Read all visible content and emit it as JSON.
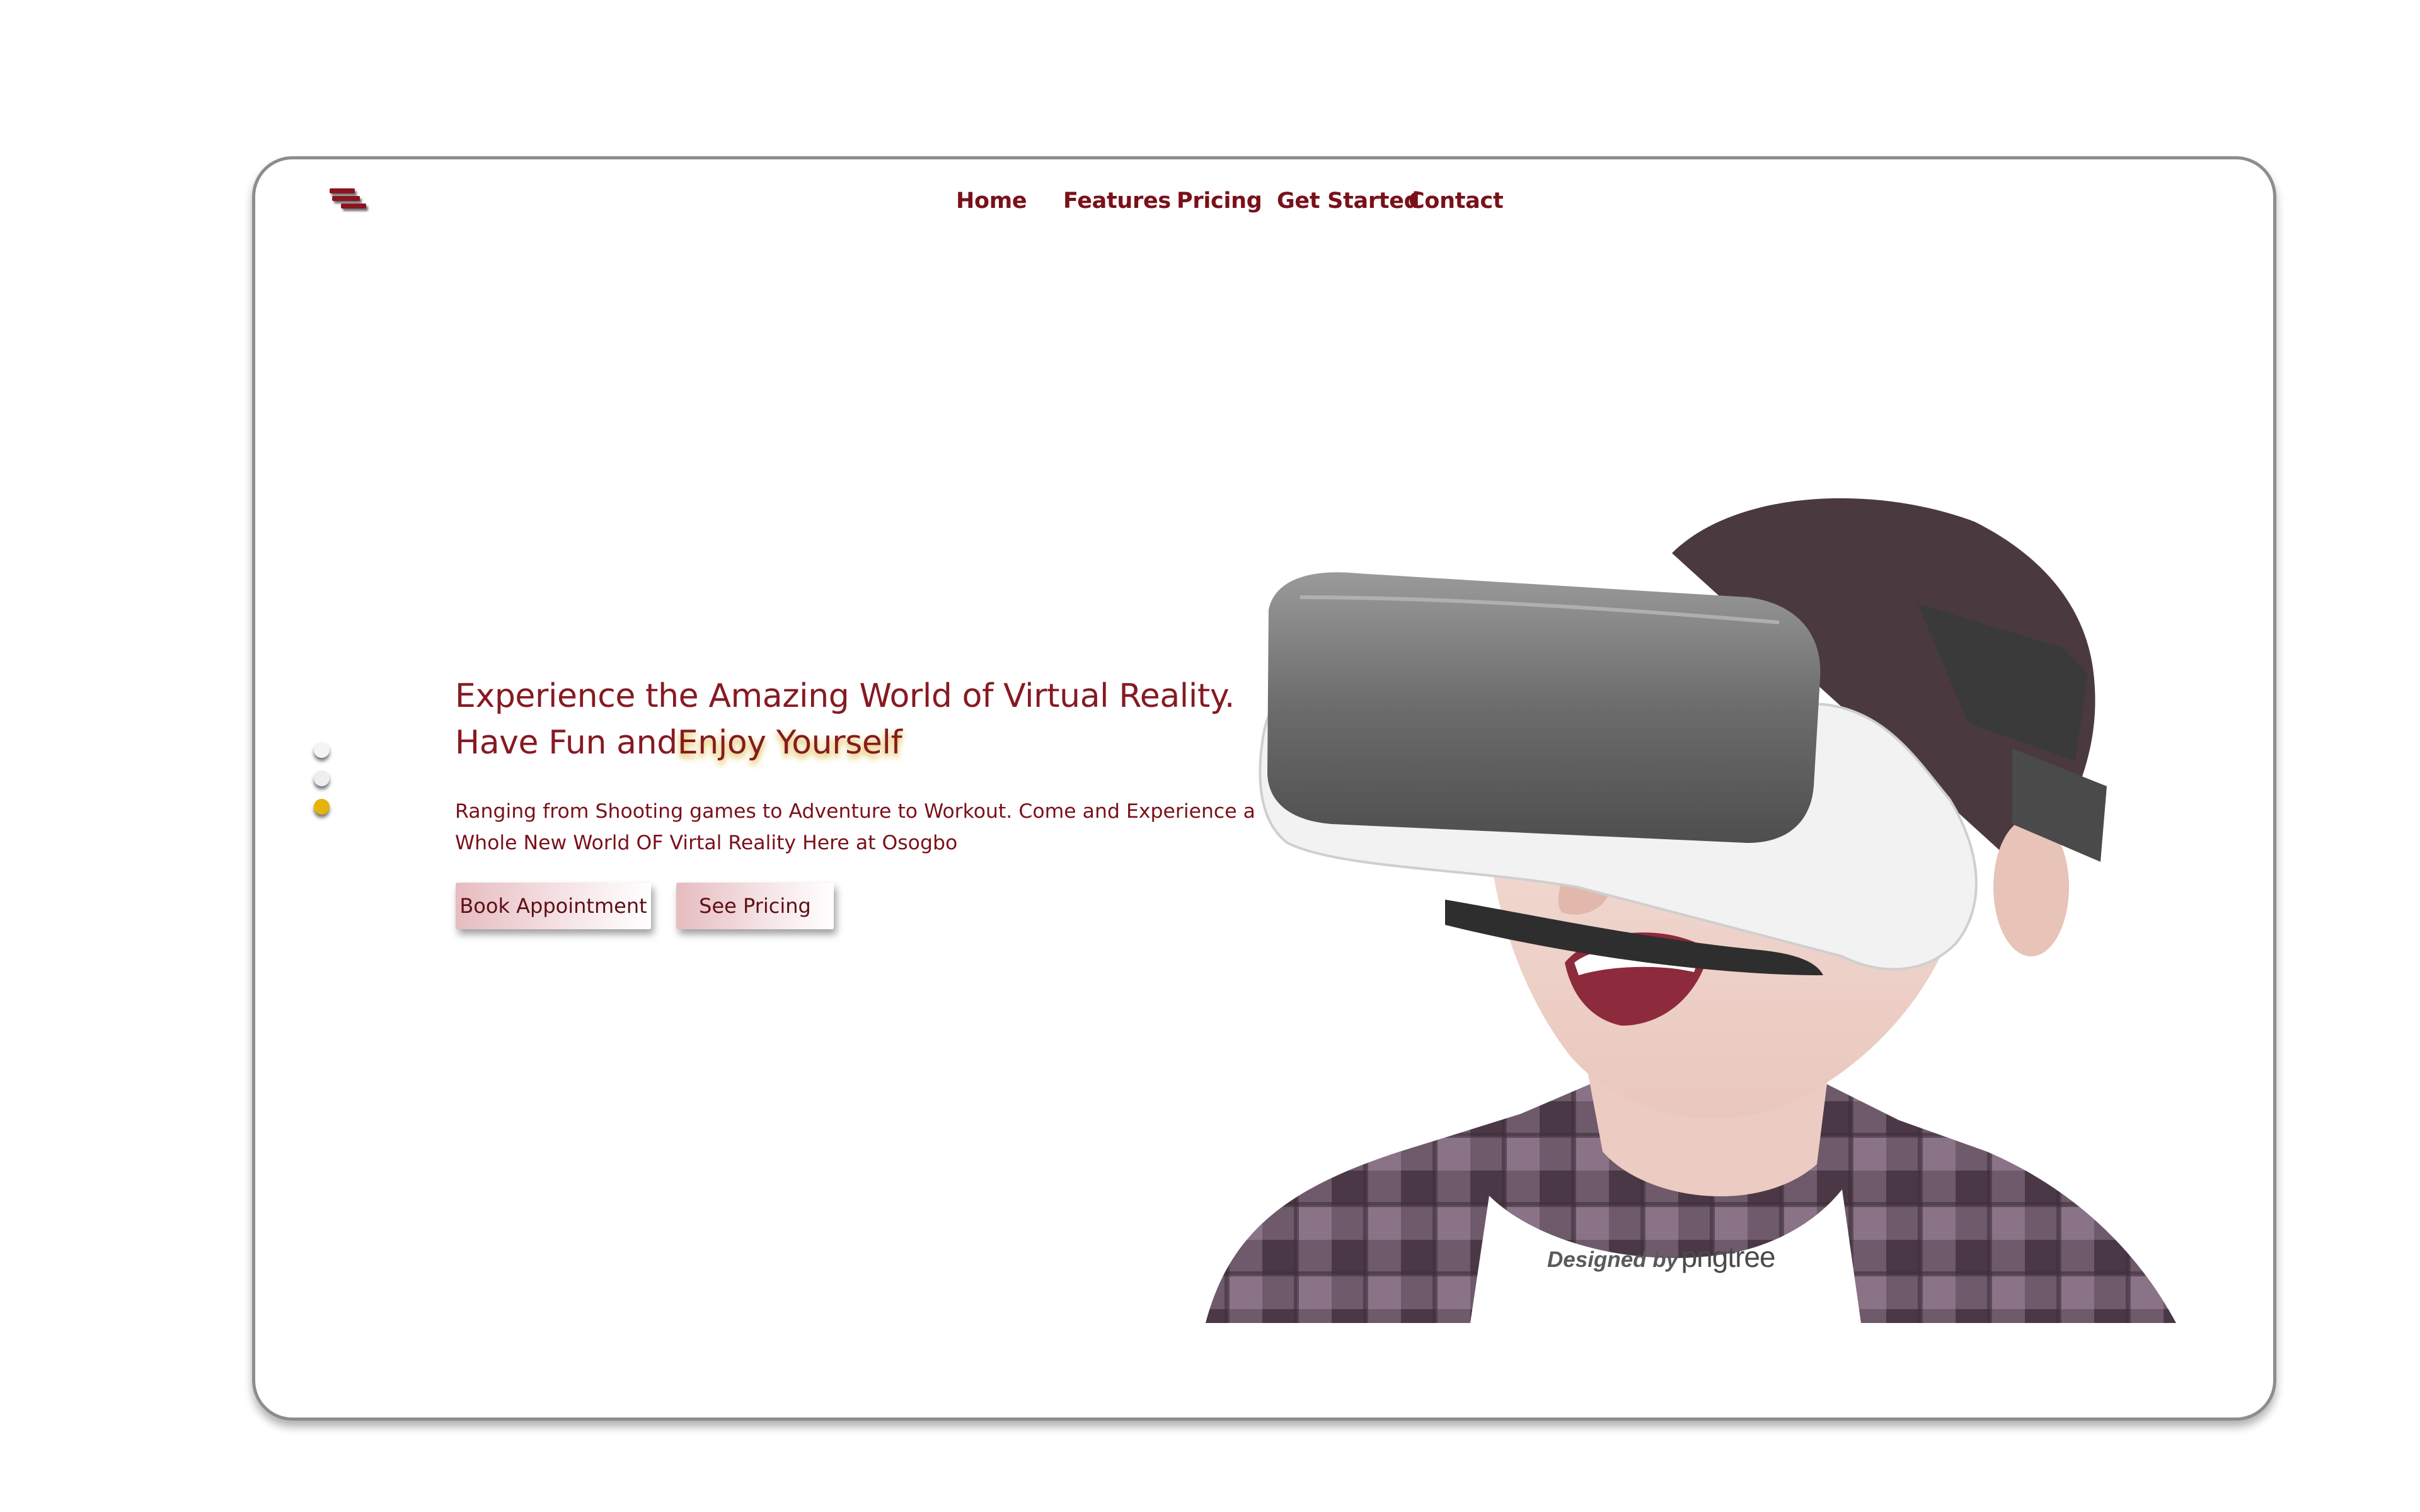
{
  "nav": {
    "items": [
      "Home",
      "Features",
      "Pricing",
      "Get Started",
      "Contact"
    ]
  },
  "hero": {
    "title_part1": "Experience the Amazing World of Virtual Reality. Have Fun and",
    "title_highlight": "Enjoy Yourself",
    "description": "Ranging from Shooting games to Adventure to Workout. Come and Experience a Whole New World OF Virtal Reality Here at Osogbo",
    "buttons": {
      "book": "Book Appointment",
      "pricing": "See Pricing"
    }
  },
  "slider": {
    "count": 3,
    "active_index": 2
  },
  "image": {
    "watermark_by": "Designed by",
    "watermark_brand": "pngtree"
  },
  "colors": {
    "brand": "#7a1019",
    "accent": "#e4b40a",
    "button_gradient_start": "#e6bcc0"
  },
  "icons": {
    "logo": "hamburger-logo-icon"
  }
}
